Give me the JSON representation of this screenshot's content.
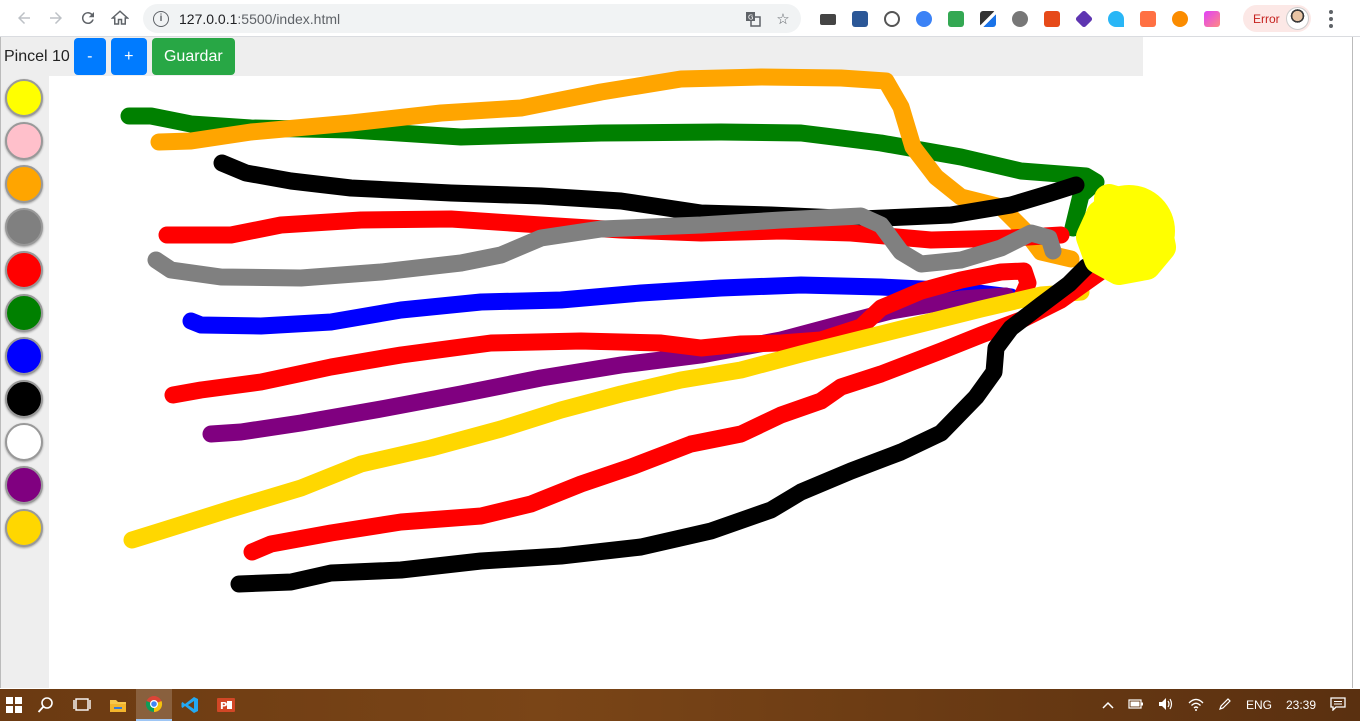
{
  "browser": {
    "url_host": "127.0.0.1",
    "url_path": ":5500/index.html",
    "profile_label": "Error",
    "icons": {
      "back": "back-arrow-icon",
      "forward": "forward-arrow-icon",
      "reload": "reload-icon",
      "home": "home-icon",
      "info": "info-icon",
      "translate": "translate-icon",
      "bookmark": "star-icon",
      "menu": "more-vert-icon"
    },
    "extensions": [
      {
        "name": "ext-printer-icon",
        "color": "#444444"
      },
      {
        "name": "ext-save-icon",
        "color": "#2b5797"
      },
      {
        "name": "ext-code-icon",
        "color": "#555555"
      },
      {
        "name": "ext-circle-icon",
        "color": "#3b82f6"
      },
      {
        "name": "ext-mail-icon",
        "color": "#34a853"
      },
      {
        "name": "ext-eyedropper-icon",
        "color": "#1a73e8"
      },
      {
        "name": "ext-gear-icon",
        "color": "#666666"
      },
      {
        "name": "ext-z-icon",
        "color": "#e64a19"
      },
      {
        "name": "ext-cube-icon",
        "color": "#5e35b1"
      },
      {
        "name": "ext-wifi-icon",
        "color": "#29b6f6"
      },
      {
        "name": "ext-orange-icon",
        "color": "#ff7043"
      },
      {
        "name": "ext-face-icon",
        "color": "#fb8c00"
      },
      {
        "name": "ext-gradient-icon",
        "color": "#e040fb"
      }
    ]
  },
  "app": {
    "brush_label": "Pincel 10",
    "minus_label": "-",
    "plus_label": "+",
    "save_label": "Guardar",
    "colors": [
      "#ffff00",
      "#ffc0cb",
      "#ffa500",
      "#808080",
      "#ff0000",
      "#008000",
      "#0000ff",
      "#000000",
      "#ffffff",
      "#800080",
      "#ffd700"
    ],
    "button_colors": {
      "primary": "#007bff",
      "success": "#28a745"
    }
  },
  "taskbar": {
    "icons": [
      "windows-start-icon",
      "search-icon",
      "task-view-icon",
      "file-explorer-icon",
      "chrome-icon",
      "vscode-icon",
      "powerpoint-icon"
    ],
    "language": "ENG",
    "time": "23:39"
  }
}
